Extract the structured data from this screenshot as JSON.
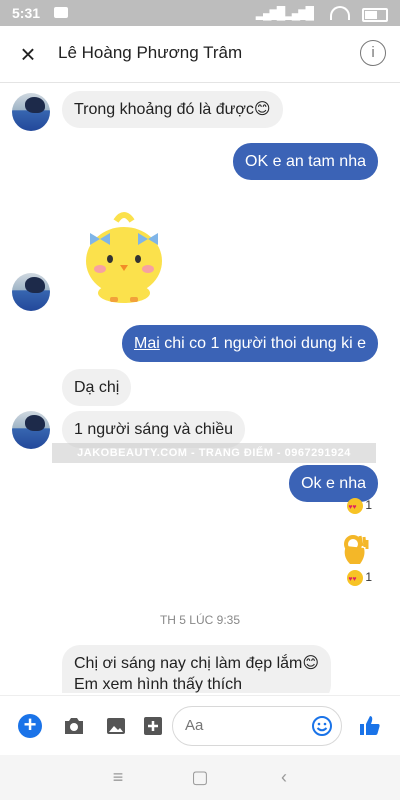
{
  "status_bar": {
    "time": "5:31"
  },
  "header": {
    "contact_name": "Lê Hoàng Phương Trâm",
    "close_glyph": "×",
    "info_glyph": "i"
  },
  "messages": [
    {
      "side": "in",
      "text": "Trong khoảng đó là được😊"
    },
    {
      "side": "out",
      "text": "OK e an tam nha"
    },
    {
      "side": "in",
      "sticker": "yellow-chick-sticker"
    },
    {
      "side": "out",
      "link_text": "Mai",
      "text": " chi co 1 người thoi dung ki e"
    },
    {
      "side": "in",
      "text": "Dạ chị"
    },
    {
      "side": "in",
      "text": "1 người sáng và chiều"
    },
    {
      "side": "out",
      "text": "Ok e nha",
      "reaction_count": "1"
    },
    {
      "side": "out",
      "sticker": "ok-hand-emoji",
      "reaction_count": "1"
    },
    {
      "side": "in",
      "text": "Chị ơi sáng nay chị làm đẹp lắm😊"
    },
    {
      "side": "in",
      "text": "Em xem hình thấy thích"
    }
  ],
  "watermark": "JAKOBEAUTY.COM - TRANG ĐIỂM - 0967291924",
  "timestamp": "TH 5 LÚC 9:35",
  "composer": {
    "placeholder": "Aa"
  },
  "colors": {
    "outgoing_bubble": "#3b63b6",
    "incoming_bubble": "#f0f0f0",
    "accent": "#1a73e8"
  }
}
